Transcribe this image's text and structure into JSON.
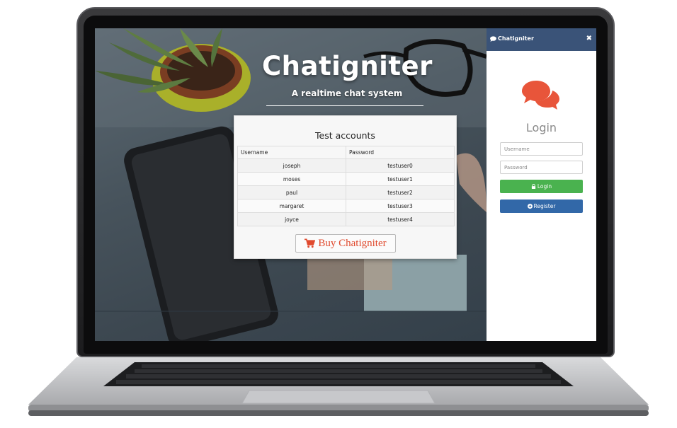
{
  "hero": {
    "title": "Chatigniter",
    "subtitle": "A realtime chat system"
  },
  "accounts_card": {
    "title": "Test accounts",
    "columns": [
      "Username",
      "Password"
    ],
    "rows": [
      {
        "username": "joseph",
        "password": "testuser0"
      },
      {
        "username": "moses",
        "password": "testuser1"
      },
      {
        "username": "paul",
        "password": "testuser2"
      },
      {
        "username": "margaret",
        "password": "testuser3"
      },
      {
        "username": "joyce",
        "password": "testuser4"
      }
    ],
    "buy_button": {
      "label": "Buy Chatigniter",
      "icon": "cart-icon"
    }
  },
  "chat_panel": {
    "header_title": "Chatigniter",
    "header_icon": "chat-bubble-icon",
    "close_label": "✖",
    "logo_icon": "chat-bubbles-icon",
    "login_title": "Login",
    "username_placeholder": "Username",
    "password_placeholder": "Password",
    "login_button": {
      "label": "Login",
      "icon": "lock-icon"
    },
    "register_button": {
      "label": "Register",
      "icon": "plus-circle-icon"
    }
  },
  "colors": {
    "panel_header": "#3a5378",
    "login_green": "#4ab24f",
    "register_blue": "#3268a8",
    "accent_orange": "#e8553a"
  }
}
